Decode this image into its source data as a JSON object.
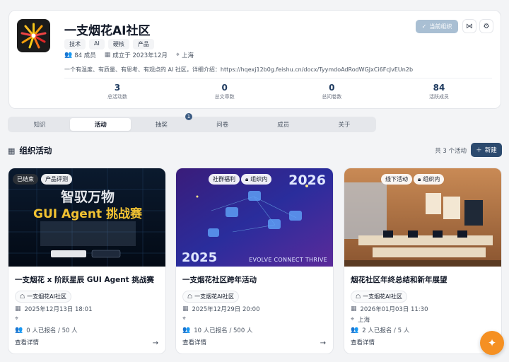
{
  "community": {
    "name": "一支烟花AI社区",
    "tags": [
      "技术",
      "AI",
      "硬核",
      "产品"
    ],
    "members_meta": "84 成员",
    "founded": "成立于 2023年12月",
    "location": "上海",
    "description": "一个有温度、有质量、有思考、有观点的 AI 社区，详细介绍：https://hqexj12b0g.feishu.cn/docx/TyymdoAdRodWGJxCi6FcJvEUn2b",
    "admin_button": "当前组织",
    "stats": [
      {
        "value": "3",
        "label": "总活动数"
      },
      {
        "value": "0",
        "label": "总文章数"
      },
      {
        "value": "0",
        "label": "总问卷数"
      },
      {
        "value": "84",
        "label": "活跃成员"
      }
    ]
  },
  "tabs": [
    "知识",
    "活动",
    "抽奖",
    "问卷",
    "成员",
    "关于"
  ],
  "tab_badge": "1",
  "section": {
    "title": "组织活动",
    "count": "共 3 个活动",
    "new_label": "新建"
  },
  "cards": [
    {
      "tags": [
        "已结束",
        "产品评测"
      ],
      "banner_title1": "智驭万物",
      "banner_title2": "GUI Agent 挑战赛",
      "title": "一支烟花 x 阶跃星辰 GUI Agent 挑战赛",
      "org": "一支烟花AI社区",
      "date": "2025年12月13日 18:01",
      "location": "",
      "signup": "0 人已报名 / 50 人",
      "detail": "查看详情"
    },
    {
      "tags": [
        "社群福利",
        "组织内"
      ],
      "banner_year_top": "2026",
      "banner_year_bottom": "2025",
      "banner_slogan": "EVOLVE CONNECT THRIVE",
      "title": "一支烟花社区跨年活动",
      "org": "一支烟花AI社区",
      "date": "2025年12月29日 20:00",
      "location": "",
      "signup": "10 人已报名 / 500 人",
      "detail": "查看详情"
    },
    {
      "tags": [
        "线下活动",
        "组织内"
      ],
      "title": "烟花社区年终总结和新年展望",
      "org": "一支烟花AI社区",
      "date": "2026年01月03日 11:30",
      "location": "上海",
      "signup": "2 人已报名 / 5 人",
      "detail": "查看详情"
    }
  ]
}
